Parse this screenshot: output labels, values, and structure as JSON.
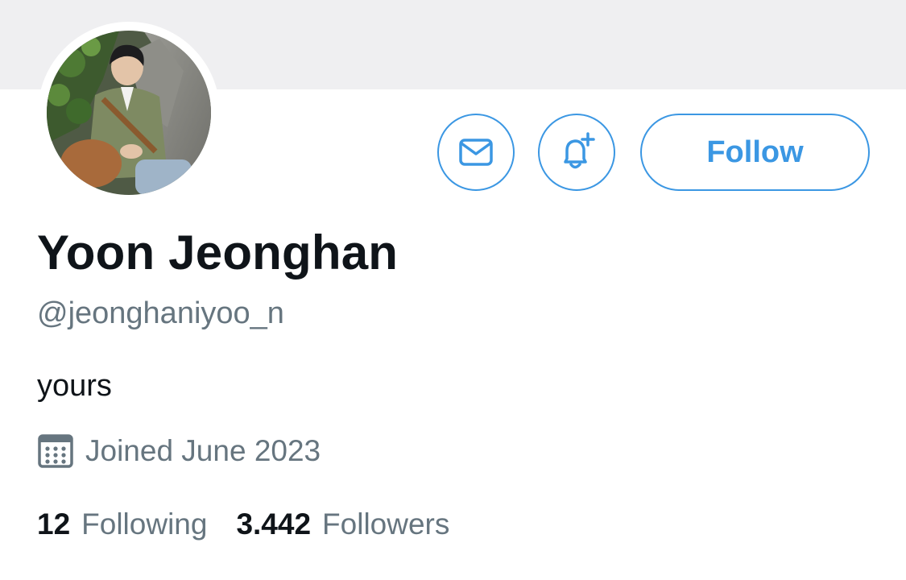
{
  "profile": {
    "display_name": "Yoon Jeonghan",
    "handle": "@jeonghaniyoo_n",
    "bio": "yours",
    "joined": "Joined June 2023"
  },
  "actions": {
    "message_icon": "envelope-icon",
    "notify_icon": "bell-plus-icon",
    "follow_label": "Follow"
  },
  "stats": {
    "following_count": "12",
    "following_label": "Following",
    "followers_count": "3.442",
    "followers_label": "Followers"
  },
  "colors": {
    "accent": "#3b97e3",
    "text_primary": "#0f1419",
    "text_secondary": "#66757f",
    "banner": "#efeff1"
  }
}
